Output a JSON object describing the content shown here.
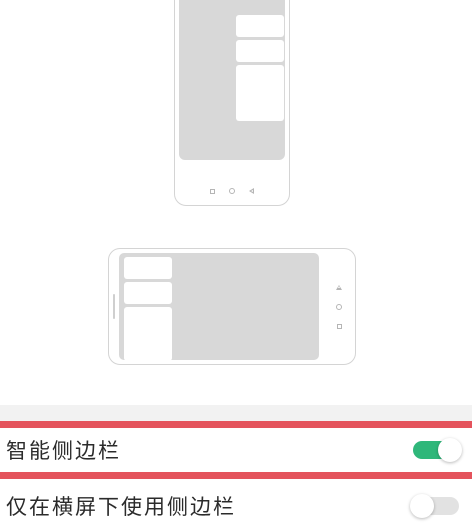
{
  "settings": {
    "smart_sidebar": {
      "label": "智能侧边栏",
      "enabled": true
    },
    "landscape_only": {
      "label": "仅在横屏下使用侧边栏",
      "enabled": false
    }
  },
  "colors": {
    "highlight": "#e4535c",
    "toggle_on": "#2fb77a",
    "toggle_off": "#e2e2e2",
    "divider": "#f2f2f2",
    "phone_screen": "#d8d8d8"
  }
}
